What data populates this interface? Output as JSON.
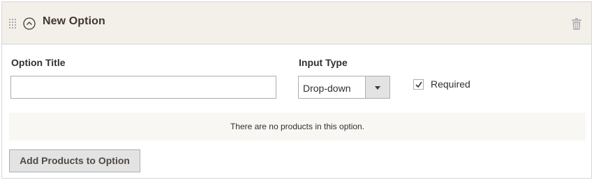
{
  "header": {
    "title": "New Option",
    "icons": [
      "drag-handle-icon",
      "collapse-circle-up-icon",
      "trash-icon"
    ]
  },
  "form": {
    "option_title_label": "Option Title",
    "option_title_value": "",
    "input_type_label": "Input Type",
    "input_type_selected": "Drop-down",
    "required_label": "Required",
    "required_checked": true
  },
  "products": {
    "empty_message": "There are no products in this option.",
    "add_button_label": "Add Products to Option"
  },
  "colors": {
    "header_bg": "#f3f0ea",
    "border": "#d6d6d6",
    "button_bg": "#e3e3e3",
    "text": "#303030"
  }
}
